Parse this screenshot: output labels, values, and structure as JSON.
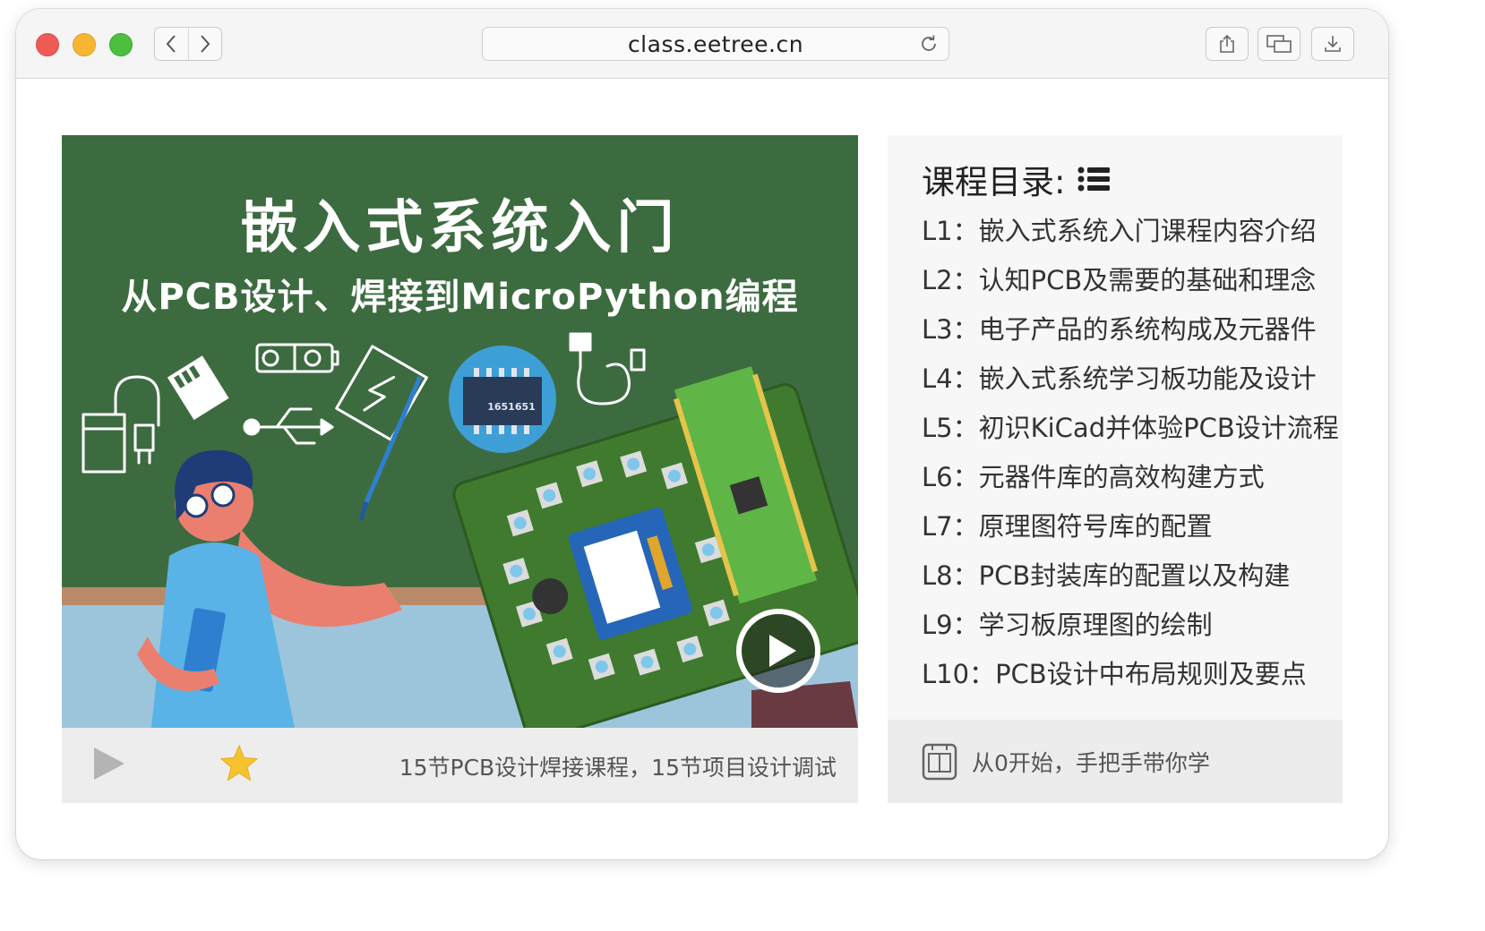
{
  "browser": {
    "url": "class.eetree.cn"
  },
  "poster": {
    "title": "嵌入式系统入门",
    "subtitle": "从PCB设计、焊接到MicroPython编程",
    "chip_label": "1651651"
  },
  "video_footer": {
    "description": "15节PCB设计焊接课程，15节项目设计调试"
  },
  "course": {
    "heading": "课程目录:",
    "lessons": [
      {
        "code": "L1：",
        "title": "嵌入式系统入门课程内容介绍"
      },
      {
        "code": "L2：",
        "title": "认知PCB及需要的基础和理念"
      },
      {
        "code": "L3：",
        "title": "电子产品的系统构成及元器件"
      },
      {
        "code": "L4：",
        "title": "嵌入式系统学习板功能及设计"
      },
      {
        "code": "L5：",
        "title": "初识KiCad并体验PCB设计流程"
      },
      {
        "code": "L6：",
        "title": "元器件库的高效构建方式"
      },
      {
        "code": "L7：",
        "title": "原理图符号库的配置"
      },
      {
        "code": "L8：",
        "title": "PCB封装库的配置以及构建"
      },
      {
        "code": "L9：",
        "title": "学习板原理图的绘制"
      },
      {
        "code": "L10：",
        "title": "PCB设计中布局规则及要点"
      }
    ],
    "footer_tag": "从0开始，手把手带你学"
  },
  "icons": {
    "traffic": [
      "close-dot",
      "minimize-dot",
      "zoom-dot"
    ],
    "nav": [
      "chevron-left-icon",
      "chevron-right-icon"
    ],
    "address": "reload-icon",
    "toolbar": [
      "share-icon",
      "tabs-icon",
      "download-icon"
    ],
    "video": [
      "play-icon",
      "star-icon",
      "big-play-icon"
    ],
    "course": [
      "list-icon",
      "book-icon"
    ]
  },
  "colors": {
    "chalkboard": "#3d6b40",
    "board_pcb": "#3f7a2e",
    "star": "#f6c32e",
    "close": "#ee5b55",
    "minimize": "#f6b632",
    "zoom": "#4cbf3f"
  }
}
